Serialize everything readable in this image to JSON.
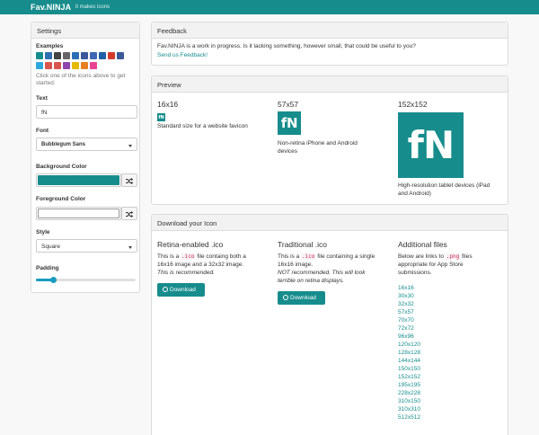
{
  "nav": {
    "brand": "Fav.NINJA",
    "tagline": "it makes icons"
  },
  "settings": {
    "title": "Settings",
    "examples_label": "Examples",
    "examples_row1": [
      {
        "name": "fn-example-icon",
        "color": "#178c8c"
      },
      {
        "name": "book-example-icon",
        "color": "#2f6fb0"
      },
      {
        "name": "d-example-icon",
        "color": "#444"
      },
      {
        "name": "m-example-icon",
        "color": "#666"
      },
      {
        "name": "t-example-icon",
        "color": "#2a6fb5"
      },
      {
        "name": "l-example-icon",
        "color": "#3b5998"
      },
      {
        "name": "b-example-icon",
        "color": "#3f66b1"
      },
      {
        "name": "dash-example-icon",
        "color": "#1f5fa6"
      },
      {
        "name": "red-circle-example-icon",
        "color": "#d33a2c"
      },
      {
        "name": "f-example-icon",
        "color": "#3b5998"
      }
    ],
    "examples_row2": [
      {
        "name": "blue-example-icon",
        "color": "#2da7dc"
      },
      {
        "name": "red-example-icon",
        "color": "#d9534f"
      },
      {
        "name": "e-example-icon",
        "color": "#d9534f"
      },
      {
        "name": "purple-example-icon",
        "color": "#8e44ad"
      },
      {
        "name": "yellow-example-icon",
        "color": "#e6b800"
      },
      {
        "name": "orange-example-icon",
        "color": "#e67e22"
      },
      {
        "name": "pink-example-icon",
        "color": "#e84393"
      }
    ],
    "help_text_1": "Click one of the icons above to get",
    "help_text_2": "started.",
    "text_label": "Text",
    "text_value": "fN",
    "font_label": "Font",
    "font_value": "Bubblegum Sans",
    "bg_label": "Background Color",
    "bg_color": "#178c8c",
    "fg_label": "Foreground Color",
    "fg_color": "#ffffff",
    "style_label": "Style",
    "style_value": "Square",
    "padding_label": "Padding",
    "padding_fraction": 0.18
  },
  "feedback": {
    "title": "Feedback",
    "text": "Fav.NINJA is a work in progress. Is it lacking something, however small, that could be useful to you?",
    "link": "Send us Feedback!"
  },
  "preview": {
    "title": "Preview",
    "icon_text": "fN",
    "small": {
      "heading": "16x16",
      "desc": "Standard size for a website favicon"
    },
    "medium": {
      "heading": "57x57",
      "desc_1": "Non-retina iPhone and Android",
      "desc_2": "devices"
    },
    "large": {
      "heading": "152x152",
      "desc_1": "High-resolution tablet devices (iPad",
      "desc_2": "and Android)"
    }
  },
  "download": {
    "title": "Download your Icon",
    "retina": {
      "heading": "Retina-enabled .ico",
      "line1_pre": "This is a ",
      "line1_code": ".ico",
      "line1_post": " file containg both a",
      "line2": "16x16 image and a 32x32 image.",
      "line3": "This is recommended.",
      "button": "Download"
    },
    "traditional": {
      "heading": "Traditional .ico",
      "line1_pre": "This is a ",
      "line1_code": ".ico",
      "line1_post": " file containing a single",
      "line2": "16x16 image.",
      "line3": "NOT recommended. This will look",
      "line4": "terrible on retina displays.",
      "button": "Download"
    },
    "additional": {
      "heading": "Additional files",
      "line1_pre": "Below are links to ",
      "line1_code": ".png",
      "line1_post": " files",
      "line2": "appropriate for App Store",
      "line3": "submissions.",
      "sizes": [
        "16x16",
        "30x30",
        "32x32",
        "57x57",
        "70x70",
        "72x72",
        "96x96",
        "120x120",
        "128x128",
        "144x144",
        "150x150",
        "152x152",
        "195x195",
        "228x228",
        "310x150",
        "310x310",
        "512x512"
      ]
    }
  }
}
